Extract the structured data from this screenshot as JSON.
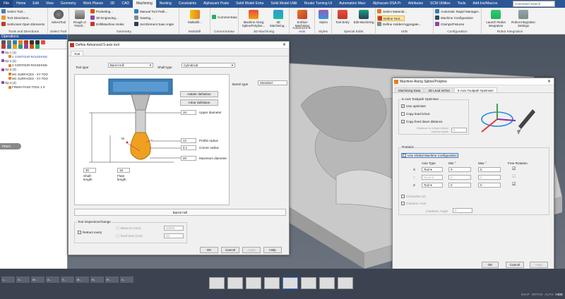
{
  "menu": {
    "items": [
      "File",
      "Home",
      "Edit",
      "View",
      "Geometry",
      "Work Planes",
      "3D",
      "CAD",
      "Machining",
      "Nesting",
      "Constraints",
      "Alphacam Posts",
      "Solid Model Extra",
      "Solid Model Utilit",
      "Router Turning Ut",
      "Automation Macr",
      "Alphacam DSA Pr",
      "Attributes",
      "SCM Utilities",
      "Tools",
      "Add-Ins/Macros"
    ],
    "active": "Machining",
    "search_placeholder": "Command Search"
  },
  "ribbon": {
    "tools_elements": {
      "label": "Tools and Directions",
      "select_tool": "Select Tool...",
      "tool_directions": "Tool Directions...",
      "set_unset": "Set/Unset Open Elements"
    },
    "select_tool_group": {
      "label": "Select Tool",
      "btn": "SelectTool"
    },
    "geometry": {
      "label": "Geometry",
      "rough": "Rough or Finish...",
      "pocketing": "Pocketing...",
      "engraving": "3D Engraving...",
      "drill": "Drill/Machine Holes",
      "manual": "Manual Tool Path...",
      "sawing": "Sawing...",
      "set_element": "Set Element Saw Angle"
    },
    "multidrill": {
      "label": "Multidrill",
      "btn": "Multidrill..."
    },
    "commonsaw": {
      "label": "CommonSaw",
      "btn": "CommonSaw"
    },
    "machining3d": {
      "label": "3D Machining",
      "spline": "Machine Along Spline/Polyline...",
      "machining3d": "3D Machining..."
    },
    "adv5": {
      "label": "Advanced 5-Axis",
      "btn": "Surface Machining"
    },
    "styles": {
      "label": "Styles",
      "btn": "Styles"
    },
    "special": {
      "label": "Special Edits",
      "tool_entry": "Tool Entry",
      "edit_machining": "Edit Machining"
    },
    "utils": {
      "label": "Utils",
      "select_material": "Select Material...",
      "define_tool": "Define Tool...",
      "define_holder": "Define Holder/Aggregate..."
    },
    "config": {
      "label": "Configuration",
      "auto_rapid": "Automatic Rapid Manager...",
      "machine_config": "Machine Configuration",
      "clamps": "Clamps/Fixtures"
    },
    "robot": {
      "label": "Robot Integration",
      "launch": "Launch Robot Integration",
      "settings": "Robot Integration Settings"
    }
  },
  "operations": {
    "title": "Operations",
    "rows": [
      {
        "label": "Op 1 (1)",
        "indent": 0
      },
      {
        "label": "2 CONTOUR ROUGHING",
        "indent": 1
      },
      {
        "label": "Op 2 (2)",
        "indent": 0
      },
      {
        "label": "2 CONTOUR ROUGHING",
        "indent": 1
      },
      {
        "label": "Op 3 (3)",
        "indent": 0
      },
      {
        "label": "MC SURFACES - XY  TOO",
        "indent": 1
      },
      {
        "label": "MC SURFACES - XY  TOO",
        "indent": 1
      },
      {
        "label": "Op 4 (4)",
        "indent": 0
      },
      {
        "label": "FINISH PASS  TOOL 1  S",
        "indent": 1
      }
    ]
  },
  "prev_button": "PREV",
  "define_tool_dialog": {
    "title": "Define Advanced 5-axis tool",
    "tab": "Tool",
    "tool_type_label": "Tool type",
    "tool_type_value": "Barrel mill",
    "shaft_type_label": "Shaft type",
    "shaft_type_value": "Cylindrical",
    "barrel_type_label": "Barrel type",
    "barrel_type_value": "Standard",
    "holder_btn": "Holder definition",
    "arbor_btn": "Arbor definition",
    "upper_diameter_label": "Upper diameter",
    "upper_diameter_value": "10",
    "profile_radius_label": "Profile radius",
    "profile_radius_value": "12",
    "corner_radius_label": "Corner radius",
    "corner_radius_value": "0.1",
    "max_diameter_label": "Maximum diameter",
    "max_diameter_value": "20",
    "shaft_length_label": "Shaft length",
    "shaft_length_value": "30",
    "flute_length_label": "Flute length",
    "flute_length_value": "18",
    "m_marker": "M",
    "preview_caption": "Barrel mill",
    "inspection_group": "Tool inspection/change",
    "retract_every": "Retract every",
    "distance_label": "distance (mm)",
    "distance_value": "10000",
    "fixed_time_label": "fixed time (min)",
    "fixed_time_value": "40",
    "ok": "OK",
    "cancel": "Cancel",
    "apply": "Apply",
    "help": "Help"
  },
  "spline_dialog": {
    "title": "Machine Along Spline/Polyline",
    "tabs": [
      "Machining Data",
      "3D Lead In/Out",
      "5-Axis Toolpath Optimiser"
    ],
    "active_tab": 2,
    "optimiser_group": "5-Axis Toolpath Optimiser",
    "use_optimiser": "Use optimiser",
    "copy_lead_in": "Copy lead in/out",
    "copy_feed_down": "Copy feed down distance",
    "distance_retract": "Distance to retract before unwind rapids",
    "distance_retract_value": "0",
    "rotation_group": "Rotation",
    "use_global": "Use Global Machine Configuration",
    "headers": {
      "axis_type": "Axis Type",
      "min": "Min °",
      "max": "Max °",
      "free": "Free Rotation"
    },
    "axes": [
      {
        "axis": "X",
        "type": "Tool",
        "min": "0",
        "max": "0",
        "free": true,
        "enabled": true
      },
      {
        "axis": "Y",
        "type": "None",
        "min": "0",
        "max": "0",
        "free": true,
        "enabled": false
      },
      {
        "axis": "Z",
        "type": "Tool",
        "min": "0",
        "max": "0",
        "free": true,
        "enabled": true
      }
    ],
    "clockwise": "Clockwise (Z)",
    "cardanic_axis": "Cardanic Axis",
    "cardanic_angle": "Cardanic Angle",
    "cardanic_angle_value": "0",
    "ok": "OK",
    "cancel": "Cancel",
    "help": "Help"
  },
  "taskbar": {
    "items": [
      "L...",
      "O...",
      "W...",
      "A...",
      "S...",
      "M...",
      "N...",
      "R...",
      "C..."
    ]
  },
  "status": {
    "items": [
      "SNAP",
      "ORTHO",
      "AUTO",
      "HIDE"
    ]
  }
}
